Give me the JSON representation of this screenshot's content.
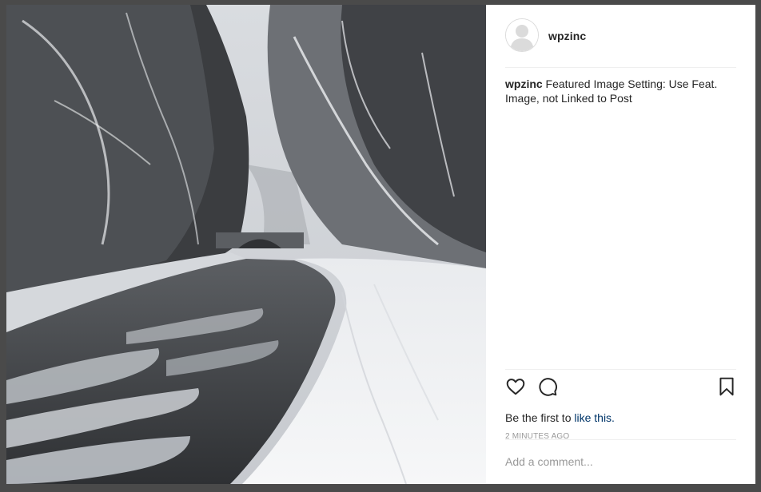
{
  "post": {
    "username": "wpzinc",
    "image_alt": "Snowy canal path with bare trees and a stone bridge",
    "caption_user": "wpzinc",
    "caption_text": " Featured Image Setting: Use Feat. Image, not Linked to Post",
    "likes_prefix": "Be the first to ",
    "likes_link": "like this.",
    "timestamp": "2 MINUTES AGO",
    "comment_placeholder": "Add a comment..."
  },
  "icons": {
    "like": "heart-icon",
    "comment": "speech-bubble-icon",
    "save": "bookmark-icon",
    "avatar": "default-avatar-icon"
  },
  "colors": {
    "link": "#003569",
    "text": "#262626",
    "muted": "#999999",
    "border": "#efefef"
  }
}
